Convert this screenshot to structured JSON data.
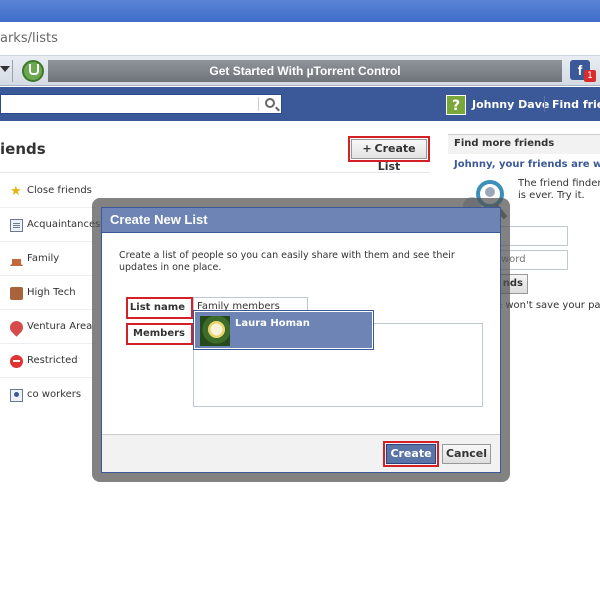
{
  "browser": {
    "url_fragment": "arks/lists",
    "toolbar_banner": "Get Started With µTorrent Control",
    "fb_badge": "f",
    "notification_count": "1"
  },
  "header": {
    "user_name": "Johnny Dave",
    "find_friends": "Find frien",
    "help_glyph": "?"
  },
  "page": {
    "title": "iends",
    "create_list_label": "Create List",
    "plus_glyph": "+"
  },
  "lists": [
    {
      "label": "Close friends",
      "icon": "star-icon"
    },
    {
      "label": "Acquaintances",
      "icon": "acquaintances-icon"
    },
    {
      "label": "Family",
      "icon": "house-icon"
    },
    {
      "label": "High Tech",
      "icon": "briefcase-icon"
    },
    {
      "label": "Ventura Area",
      "icon": "location-pin-icon"
    },
    {
      "label": "Restricted",
      "icon": "restricted-icon"
    },
    {
      "label": "co workers",
      "icon": "person-card-icon"
    }
  ],
  "right_column": {
    "header": "Find more friends",
    "subheading": "Johnny, your friends are wait",
    "description": "The friend finder is ever. Try it.",
    "password_placeholder": "word",
    "button_label": "nds",
    "note": "e won't save your pass"
  },
  "modal": {
    "title": "Create New List",
    "description": "Create a list of people so you can easily share with them and see their updates in one place.",
    "list_name_label": "List name",
    "list_name_value": "Family members",
    "members_label": "Members",
    "suggestion_name": "Laura Homan",
    "create_label": "Create",
    "cancel_label": "Cancel"
  },
  "colors": {
    "facebook_blue": "#3b5998",
    "modal_header": "#6d84b4",
    "highlight_red": "#d42027"
  }
}
